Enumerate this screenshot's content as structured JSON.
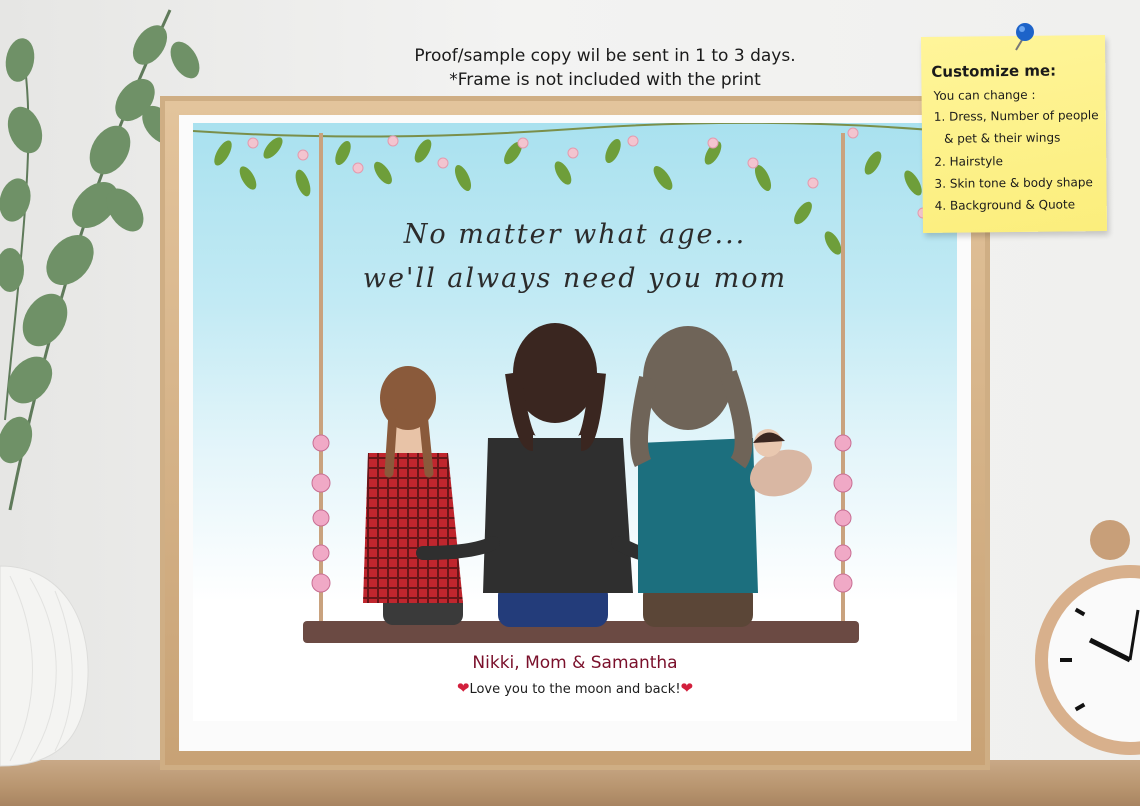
{
  "header": {
    "line1": "Proof/sample copy wil be sent in 1 to 3 days.",
    "line2": "*Frame is not included with the print"
  },
  "artwork": {
    "quote_line1": "No matter what age...",
    "quote_line2": "we'll always need you mom",
    "names": "Nikki, Mom & Samantha",
    "love_text": "Love you to the moon and back!",
    "heart_glyph": "❤"
  },
  "note": {
    "title": "Customize me:",
    "lines": [
      "You can change :",
      "1. Dress, Number of people",
      "& pet & their wings",
      "2. Hairstyle",
      "3. Skin tone & body shape",
      "4. Background & Quote"
    ]
  },
  "colors": {
    "names": "#7a0f2a",
    "heart": "#d21f3c",
    "note": "#fbee7c",
    "frame": "#cfae84"
  }
}
